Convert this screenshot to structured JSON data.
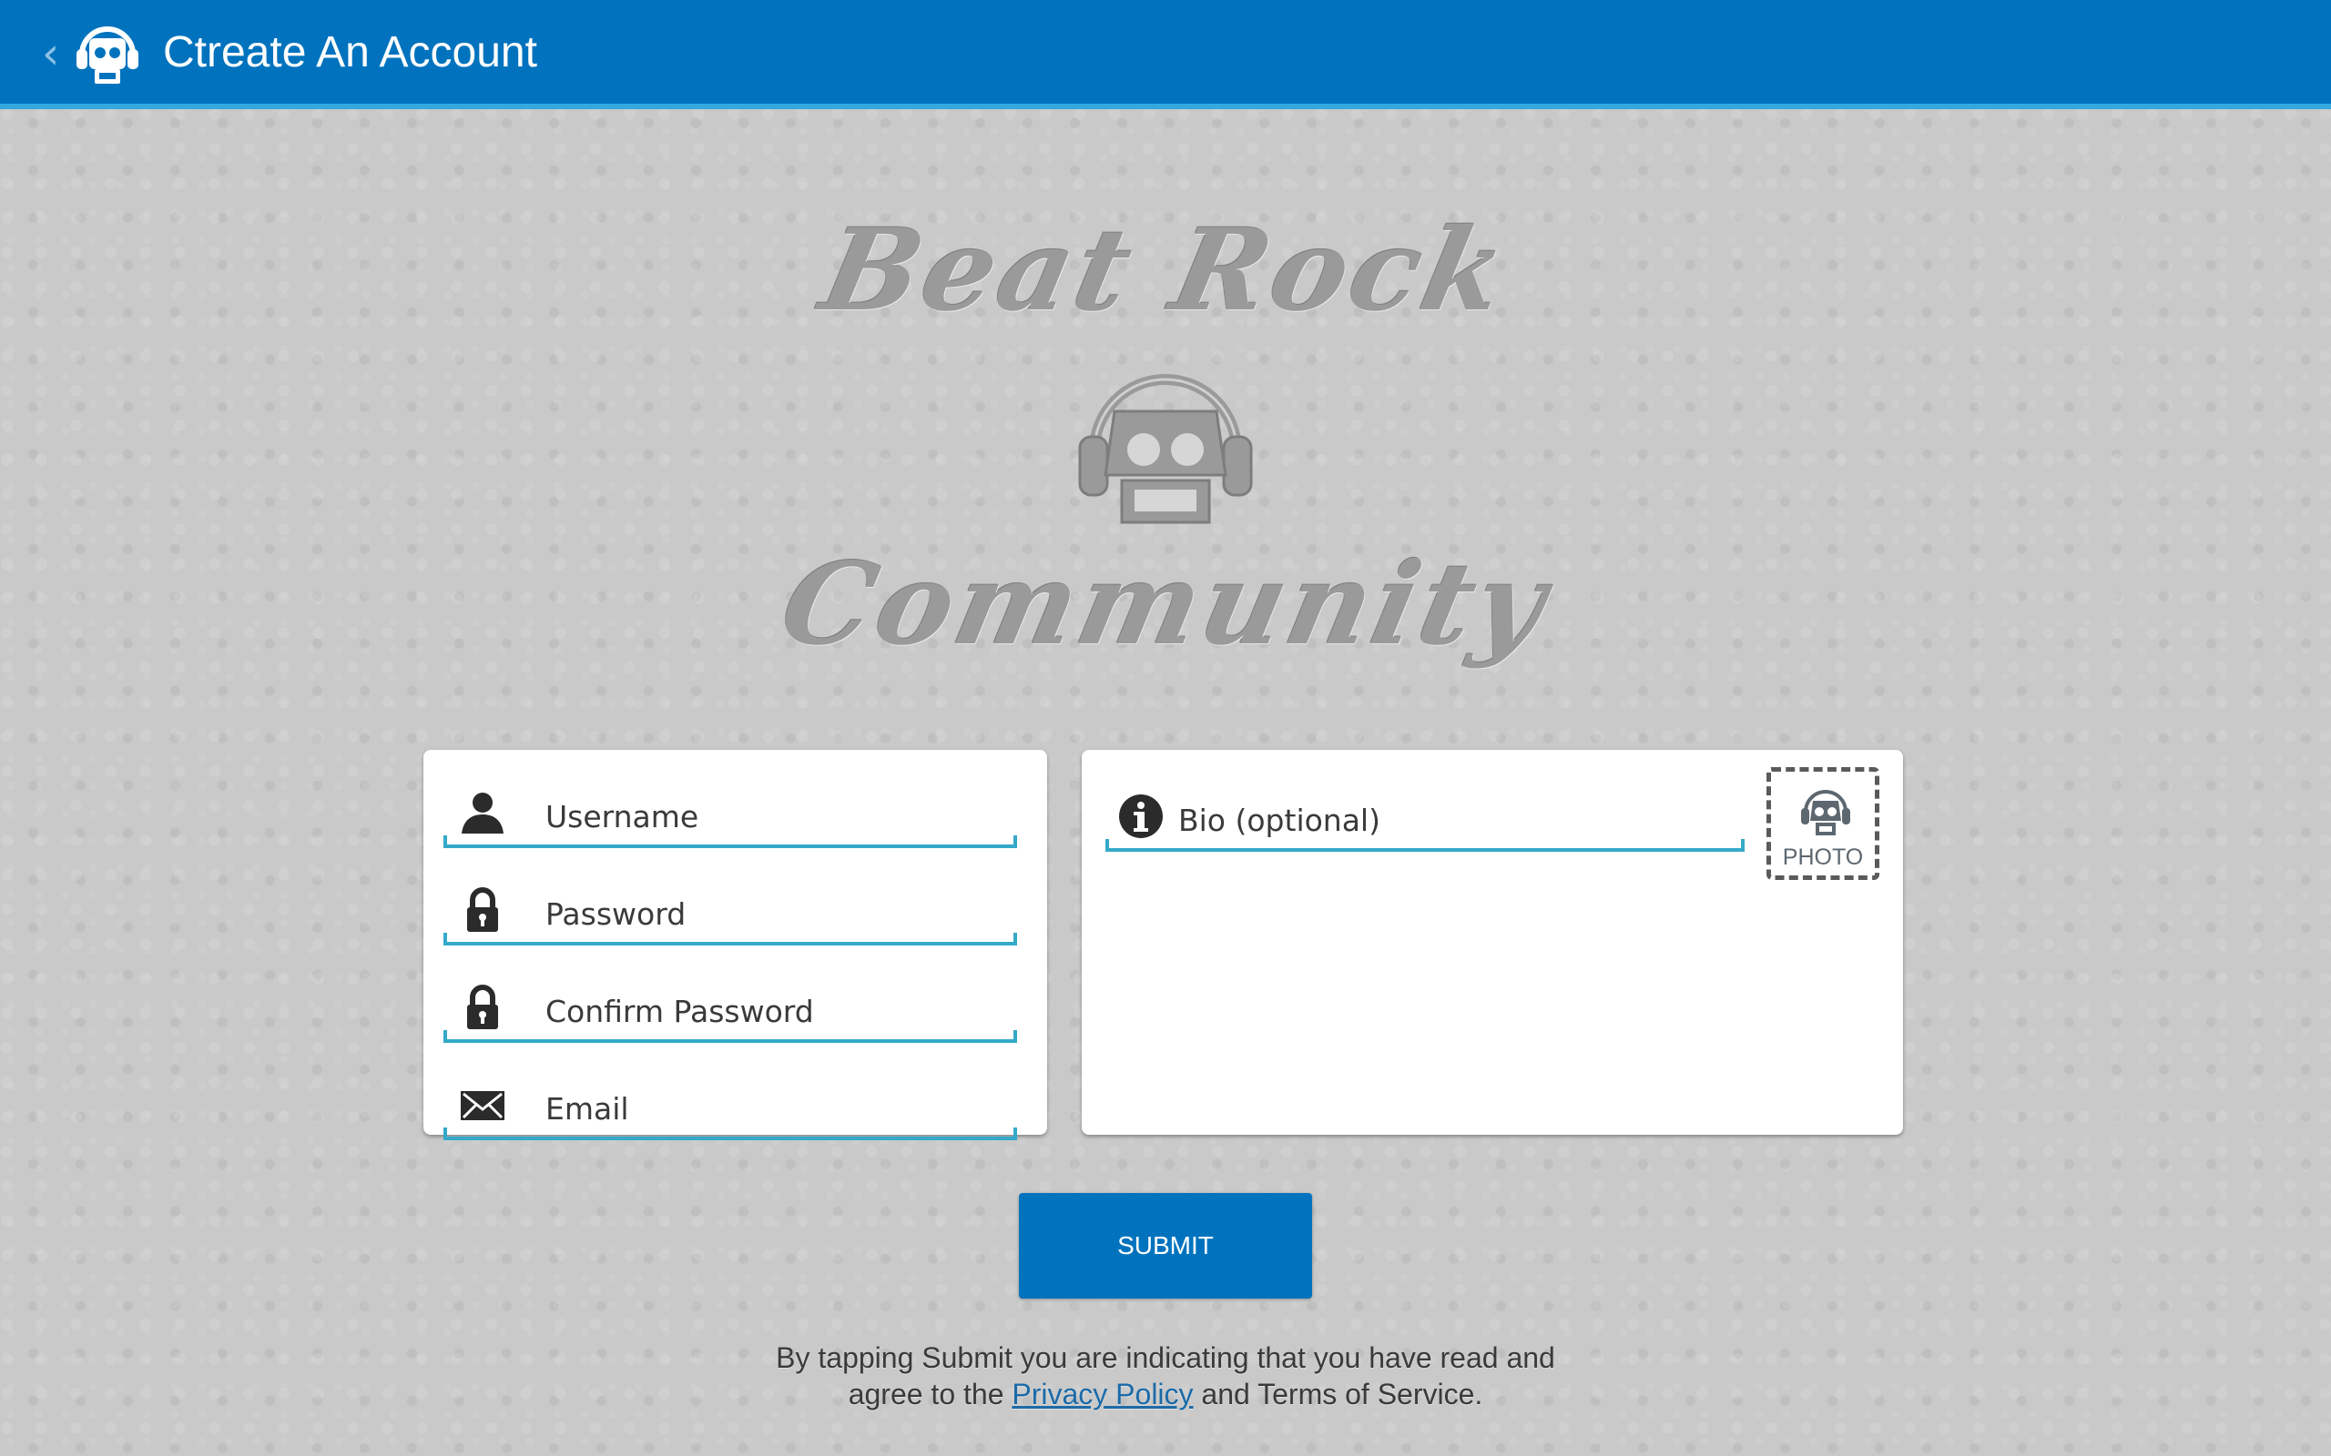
{
  "appbar": {
    "back_glyph": "‹",
    "title": "Ctreate An Account",
    "logo_icon": "robot-headphones-icon"
  },
  "hero": {
    "top_text": "Beat Rock",
    "bottom_text": "Community",
    "robot_icon": "robot-headphones-icon"
  },
  "form": {
    "username": {
      "placeholder": "Username",
      "value": "",
      "icon": "user-icon"
    },
    "password": {
      "placeholder": "Password",
      "value": "",
      "icon": "lock-icon"
    },
    "confirm_password": {
      "placeholder": "Confirm Password",
      "value": "",
      "icon": "lock-icon"
    },
    "email": {
      "placeholder": "Email",
      "value": "",
      "icon": "mail-icon"
    },
    "bio": {
      "placeholder": "Bio (optional)",
      "value": "",
      "icon": "info-icon"
    },
    "photo": {
      "label": "PHOTO",
      "icon": "robot-headphones-icon"
    }
  },
  "submit": {
    "label": "SUBMIT"
  },
  "terms": {
    "line1": "By tapping Submit you are indicating that you have read and",
    "line2_prefix": "agree to the ",
    "privacy_link": "Privacy Policy",
    "line2_suffix": " and Terms of Service."
  },
  "colors": {
    "appbar": "#0173be",
    "appbar_accent": "#34a9e0",
    "field_underline": "#34a9c9",
    "background": "#c9c9c9",
    "submit": "#0173be"
  }
}
